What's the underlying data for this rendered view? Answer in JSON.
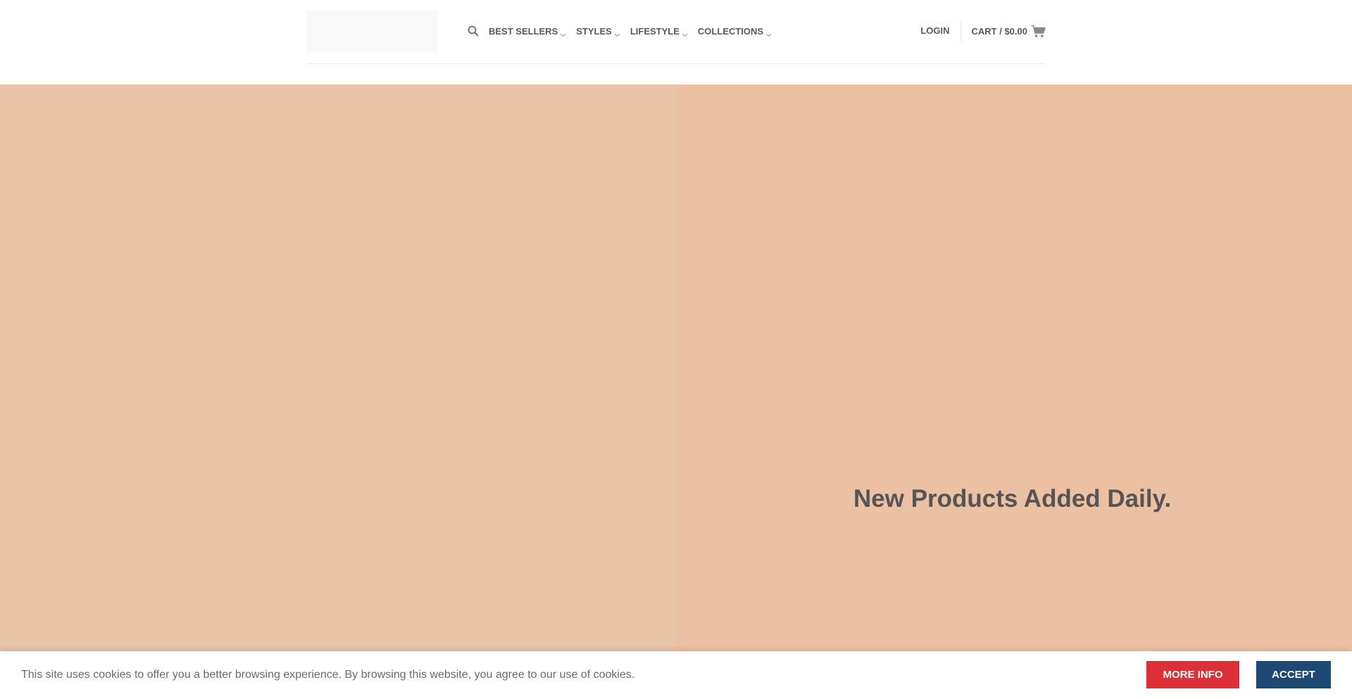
{
  "header": {
    "nav": [
      {
        "label": "BEST SELLERS",
        "has_dropdown": true
      },
      {
        "label": "STYLES",
        "has_dropdown": true
      },
      {
        "label": "LIFESTYLE",
        "has_dropdown": true
      },
      {
        "label": "COLLECTIONS",
        "has_dropdown": true
      }
    ],
    "login_label": "LOGIN",
    "cart_label": "CART / $0.00",
    "icons": {
      "search": "search-icon",
      "cart": "shopping-cart-icon",
      "dropdown": "chevron-down-icon"
    }
  },
  "hero": {
    "heading": "New Products Added Daily."
  },
  "cookie_bar": {
    "message": "This site uses cookies to offer you a better browsing experience. By browsing this website, you agree to our use of cookies.",
    "more_info_label": "MORE INFO",
    "accept_label": "ACCEPT"
  },
  "colors": {
    "hero_left": "#e8c4a8",
    "hero_right": "#ecc0a2",
    "text_dark": "#555555",
    "more_info_button": "#de2f36",
    "accept_button": "#1d4a75"
  }
}
